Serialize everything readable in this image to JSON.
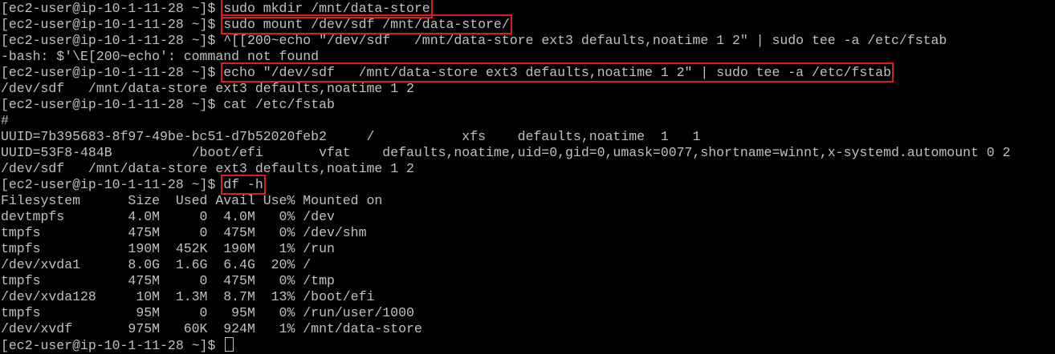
{
  "terminal": {
    "text_color": "#c0c0c0",
    "background_color": "#000000",
    "highlight_color": "#d81e1e",
    "prompt": "[ec2-user@ip-10-1-11-28 ~]$ ",
    "lines": [
      {
        "prompt": "[ec2-user@ip-10-1-11-28 ~]$ ",
        "text": "sudo mkdir /mnt/data-store"
      },
      {
        "prompt": "[ec2-user@ip-10-1-11-28 ~]$ ",
        "text": "sudo mount /dev/sdf /mnt/data-store/"
      },
      {
        "prompt": "[ec2-user@ip-10-1-11-28 ~]$ ",
        "text": "^[[200~echo \"/dev/sdf   /mnt/data-store ext3 defaults,noatime 1 2\" | sudo tee -a /etc/fstab"
      },
      {
        "text": "-bash: $'\\E[200~echo': command not found"
      },
      {
        "prompt": "[ec2-user@ip-10-1-11-28 ~]$ ",
        "text": "echo \"/dev/sdf   /mnt/data-store ext3 defaults,noatime 1 2\" | sudo tee -a /etc/fstab"
      },
      {
        "text": "/dev/sdf   /mnt/data-store ext3 defaults,noatime 1 2"
      },
      {
        "prompt": "[ec2-user@ip-10-1-11-28 ~]$ ",
        "text": "cat /etc/fstab"
      },
      {
        "text": "#"
      },
      {
        "text": "UUID=7b395683-8f97-49be-bc51-d7b52020feb2     /           xfs    defaults,noatime  1   1"
      },
      {
        "text": "UUID=53F8-484B          /boot/efi       vfat    defaults,noatime,uid=0,gid=0,umask=0077,shortname=winnt,x-systemd.automount 0 2"
      },
      {
        "text": "/dev/sdf   /mnt/data-store ext3 defaults,noatime 1 2"
      },
      {
        "prompt": "[ec2-user@ip-10-1-11-28 ~]$ ",
        "text": "df -h"
      },
      {
        "text": "Filesystem      Size  Used Avail Use% Mounted on"
      },
      {
        "text": "devtmpfs        4.0M     0  4.0M   0% /dev"
      },
      {
        "text": "tmpfs           475M     0  475M   0% /dev/shm"
      },
      {
        "text": "tmpfs           190M  452K  190M   1% /run"
      },
      {
        "text": "/dev/xvda1      8.0G  1.6G  6.4G  20% /"
      },
      {
        "text": "tmpfs           475M     0  475M   0% /tmp"
      },
      {
        "text": "/dev/xvda128     10M  1.3M  8.7M  13% /boot/efi"
      },
      {
        "text": "tmpfs            95M     0   95M   0% /run/user/1000"
      },
      {
        "text": "/dev/xvdf       975M   60K  924M   1% /mnt/data-store"
      },
      {
        "prompt": "[ec2-user@ip-10-1-11-28 ~]$ ",
        "text": ""
      }
    ]
  }
}
